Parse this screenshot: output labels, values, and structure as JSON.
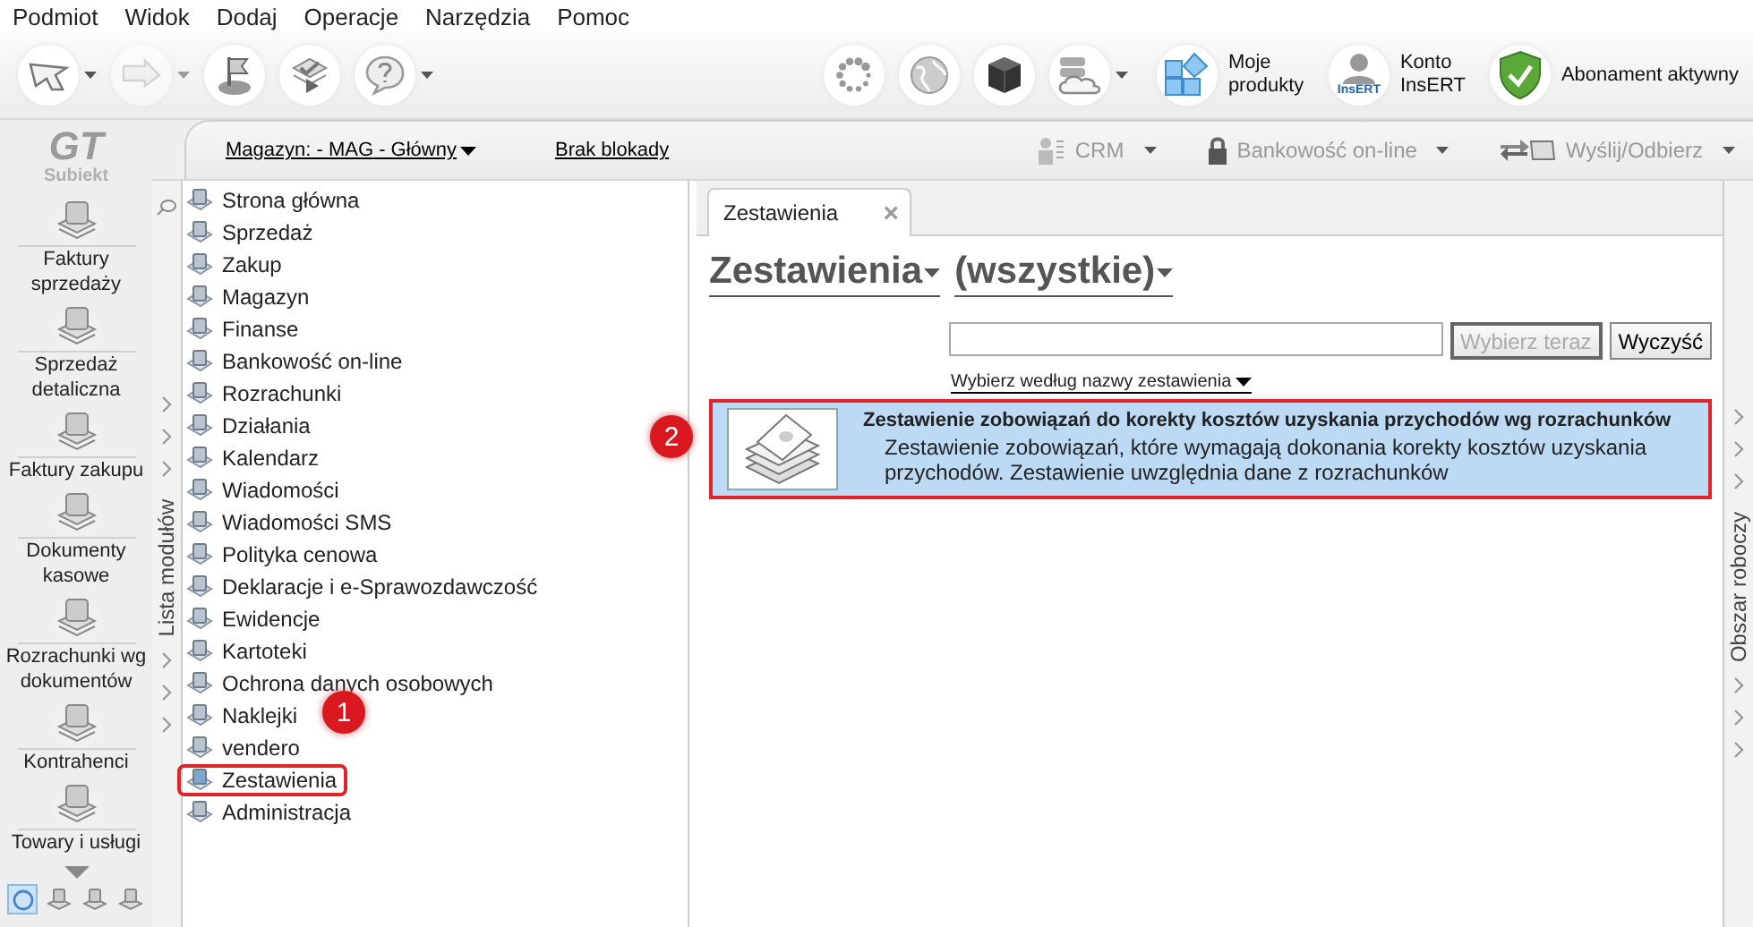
{
  "menu": [
    "Podmiot",
    "Widok",
    "Dodaj",
    "Operacje",
    "Narzędzia",
    "Pomoc"
  ],
  "toolbar": {
    "left": [
      {
        "kind": "back",
        "dropdown": true,
        "disabled": false
      },
      {
        "kind": "forward",
        "dropdown": true,
        "disabled": true
      },
      {
        "kind": "flag",
        "dropdown": false,
        "disabled": false
      },
      {
        "kind": "check",
        "dropdown": false,
        "disabled": false
      },
      {
        "kind": "help",
        "dropdown": true,
        "disabled": false
      }
    ],
    "right": [
      {
        "kind": "spinner",
        "dropdown": false
      },
      {
        "kind": "globe",
        "dropdown": false
      },
      {
        "kind": "cube",
        "dropdown": false
      },
      {
        "kind": "cloud",
        "dropdown": true
      }
    ],
    "links": [
      {
        "kind": "products",
        "label": "Moje produkty"
      },
      {
        "kind": "account",
        "label": "Konto InsERT",
        "badge": "InsERT"
      },
      {
        "kind": "shield",
        "label": "Abonament aktywny"
      }
    ]
  },
  "header": {
    "warehouse": "Magazyn: - MAG - Główny",
    "lock": "Brak blokady",
    "actions": [
      {
        "kind": "crm",
        "label": "CRM",
        "disabled": true
      },
      {
        "kind": "bank",
        "label": "Bankowość on-line",
        "disabled": true
      },
      {
        "kind": "send",
        "label": "Wyślij/Odbierz",
        "disabled": true
      }
    ]
  },
  "sidebar": {
    "logo": {
      "mark": "GT",
      "name": "Subiekt"
    },
    "shortcuts": [
      "Faktury sprzedaży",
      "Sprzedaż detaliczna",
      "Faktury zakupu",
      "Dokumenty kasowe",
      "Rozrachunki wg dokumentów",
      "Kontrahenci",
      "Towary i usługi"
    ],
    "views": [
      {
        "selected": true
      },
      {
        "selected": false
      },
      {
        "selected": false
      },
      {
        "selected": false
      }
    ]
  },
  "modules": {
    "label": "Lista modułów",
    "items": [
      {
        "label": "Strona główna",
        "highlighted": false
      },
      {
        "label": "Sprzedaż",
        "highlighted": false
      },
      {
        "label": "Zakup",
        "highlighted": false
      },
      {
        "label": "Magazyn",
        "highlighted": false
      },
      {
        "label": "Finanse",
        "highlighted": false
      },
      {
        "label": "Bankowość on-line",
        "highlighted": false
      },
      {
        "label": "Rozrachunki",
        "highlighted": false
      },
      {
        "label": "Działania",
        "highlighted": false
      },
      {
        "label": "Kalendarz",
        "highlighted": false
      },
      {
        "label": "Wiadomości",
        "highlighted": false
      },
      {
        "label": "Wiadomości SMS",
        "highlighted": false
      },
      {
        "label": "Polityka cenowa",
        "highlighted": false
      },
      {
        "label": "Deklaracje i e-Sprawozdawczość",
        "highlighted": false
      },
      {
        "label": "Ewidencje",
        "highlighted": false
      },
      {
        "label": "Kartoteki",
        "highlighted": false
      },
      {
        "label": "Ochrona danych osobowych",
        "highlighted": false
      },
      {
        "label": "Naklejki",
        "highlighted": false
      },
      {
        "label": "vendero",
        "highlighted": false
      },
      {
        "label": "Zestawienia",
        "highlighted": true
      },
      {
        "label": "Administracja",
        "highlighted": false
      }
    ]
  },
  "content": {
    "tab": {
      "label": "Zestawienia",
      "selected": true,
      "close": "×"
    },
    "filters": [
      "Zestawienia",
      "(wszystkie)"
    ],
    "buttons": [
      {
        "label": "Wybierz teraz",
        "disabled": true
      },
      {
        "label": "Wyczyść",
        "disabled": false
      }
    ],
    "sort_link": "Wybierz według nazwy zestawienia",
    "results": [
      {
        "title": "Zestawienie zobowiązań do korekty kosztów uzyskania przychodów wg rozrachunków",
        "description": "Zestawienie zobowiązań, które wymagają dokonania korekty kosztów uzyskania przychodów. Zestawienie uwzględnia dane z rozrachunków",
        "selected": true,
        "highlighted": true
      }
    ]
  },
  "workspace": {
    "label": "Obszar roboczy"
  },
  "annotations": [
    {
      "label": "1"
    },
    {
      "label": "2"
    }
  ]
}
